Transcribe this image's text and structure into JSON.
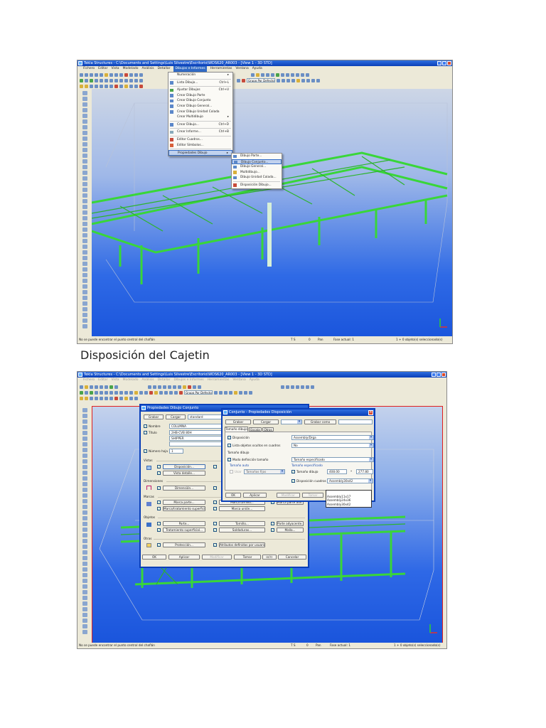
{
  "screenshot1": {
    "title": "Tekla Structures - C:\\Documents and Settings\\Luis Silvestre\\Escritorio\\WDS620_AR003 - [View 1 - 3D STD]",
    "menu": [
      "Fichero",
      "Editar",
      "Vista",
      "Modelado",
      "Análisis",
      "Detallar",
      "Dibujos e Informes",
      "Herramientas",
      "Ventana",
      "Ayuda"
    ],
    "combo": "Grupo Por Defecto",
    "dropdown": [
      {
        "label": "Numeración",
        "shortcut": "▸"
      },
      {
        "label": "Lista Dibujo...",
        "shortcut": "Ctrl+L"
      },
      {
        "label": "Ajustar Dibujos",
        "shortcut": "Ctrl+U"
      },
      {
        "label": "Crear Dibujo Parte",
        "shortcut": ""
      },
      {
        "label": "Crear Dibujo Conjunto",
        "shortcut": ""
      },
      {
        "label": "Crear Dibujo General...",
        "shortcut": ""
      },
      {
        "label": "Crear Dibujo Unidad Colada",
        "shortcut": ""
      },
      {
        "label": "Crear Multidibujo",
        "shortcut": "▸"
      },
      {
        "label": "Crear Dibujo...",
        "shortcut": "Ctrl+D"
      },
      {
        "label": "Crear Informe...",
        "shortcut": "Ctrl+B"
      },
      {
        "label": "Editor Cuadros...",
        "shortcut": ""
      },
      {
        "label": "Editor Símbolos...",
        "shortcut": ""
      },
      {
        "label": "Propiedades Dibujo",
        "shortcut": "▸"
      }
    ],
    "submenu": [
      "Dibujo Parte...",
      "Dibujo Conjunto...",
      "Dibujo General...",
      "Multidibujo...",
      "Dibujo Unidad Colada...",
      "Disposición Dibujo..."
    ],
    "status": {
      "message": "No se puede encontrar el punto central del chaflán",
      "mode": "T S",
      "snap": "0",
      "pan": "Pan",
      "phase": "Fase actual: 1",
      "selection": "1 + 0 objeto(s) seleccionado(s)"
    }
  },
  "caption": "Disposición del Cajetin",
  "screenshot2": {
    "title": "Tekla Structures - C:\\Documents and Settings\\Luis Silvestre\\Escritorio\\WDS620_AR003 - [View 1 - 3D STD]",
    "menu": [
      "Fichero",
      "Editar",
      "Vista",
      "Modelado",
      "Análisis",
      "Detallar",
      "Dibujos e Informes",
      "Herramientas",
      "Ventana",
      "Ayuda"
    ],
    "combo": "Grupo Por Defecto",
    "dialog1": {
      "title": "Propiedades Dibujo Conjunto",
      "save": "Grabar",
      "load": "Cargar",
      "preset": "standard",
      "name_label": "Nombre",
      "name": "COLUMNA",
      "title_label": "Título",
      "title1": "2HB-CVB 80H",
      "title2": "SHIPPER",
      "sheet_label": "Número hoja",
      "sheet": "1",
      "views": "Vistas",
      "layout_btn": "Disposición...",
      "detail_btn": "Vista detalle...",
      "dimensions": "Dimensiones",
      "dimension_btn": "Dimensión...",
      "marks": "Marcas",
      "part_mark": "Marca parte...",
      "bolt_mark": "Marca tornillo...",
      "adj_mark": "Marca parte adir...",
      "surface_mark": "Marca/tratamiento superficial...",
      "weld_mark": "Marca unión...",
      "objects": "Objetos",
      "part": "Parte...",
      "bolt": "Tornillo...",
      "adj_part": "Parte adyacente...",
      "surface": "Tratamiento superficial...",
      "welds": "Soldaduras...",
      "grid": "Malla...",
      "others": "Otras",
      "protection": "Protección...",
      "udas": "Atributos definidos por usuario...",
      "ok": "OK",
      "apply": "Aplicar",
      "modify": "Modificar",
      "get": "Tomar",
      "toggle": "☑/☐",
      "cancel": "Cancelar"
    },
    "dialog2": {
      "title": "Conjunto - Propiedades Disposición",
      "save": "Grabar",
      "load": "Cargar",
      "save_as": "Grabar como",
      "tabs": [
        "Tamaño dibujo",
        "Escala",
        "Otros"
      ],
      "layout_label": "Disposición",
      "layout": "Assembly/Drga",
      "hidden_label": "Lista objetos ocultos en cuadros",
      "hidden": "No",
      "size_group": "Tamaño dibujo",
      "mode_label": "Modo definición tamaño",
      "mode": "Tamaño especificado",
      "auto_group": "Tamaño auto",
      "use": "Usar",
      "fixed": "Tamaños fijos",
      "spec_group": "Tamaño especificado",
      "size_label": "Tamaño dibujo",
      "width": "408.00",
      "height": "277.80",
      "x": "*",
      "table_label": "Disposición cuadros",
      "table": "Assembly30x42",
      "table_options": [
        "",
        "Assembly11x17",
        "Assembly24x36",
        "Assembly30x42"
      ],
      "ok": "OK",
      "apply": "Aplicar",
      "modify": "Modificar",
      "get": "Tomar"
    },
    "status": {
      "message": "No se puede encontrar el punto central del chaflán",
      "mode": "T S",
      "snap": "0",
      "pan": "Pan",
      "phase": "Fase actual: 1",
      "selection": "1 + 0 objeto(s) seleccionado(s)"
    }
  },
  "colors": {
    "steel": "#38d038",
    "viewport_top": "#c9d6ec",
    "viewport_bottom": "#1f5de0",
    "selection": "#e02020"
  }
}
